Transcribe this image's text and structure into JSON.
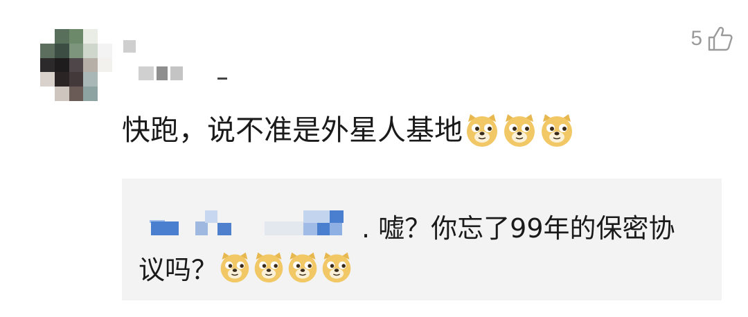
{
  "comment": {
    "like_count": "5",
    "like_icon": "thumbs-up-icon",
    "text": "快跑，说不准是外星人基地",
    "emoji_count": 3,
    "emoji_icon": "doge-emoji-icon"
  },
  "reply": {
    "text_line1": ". 嘘？你忘了99年的保密协",
    "text_line2": "议吗？",
    "emoji_count": 4,
    "emoji_icon": "doge-emoji-icon"
  },
  "colors": {
    "like": "#9a9a9a",
    "reply_background": "#f3f3f3",
    "redacted_name": "#4a7fcf"
  }
}
